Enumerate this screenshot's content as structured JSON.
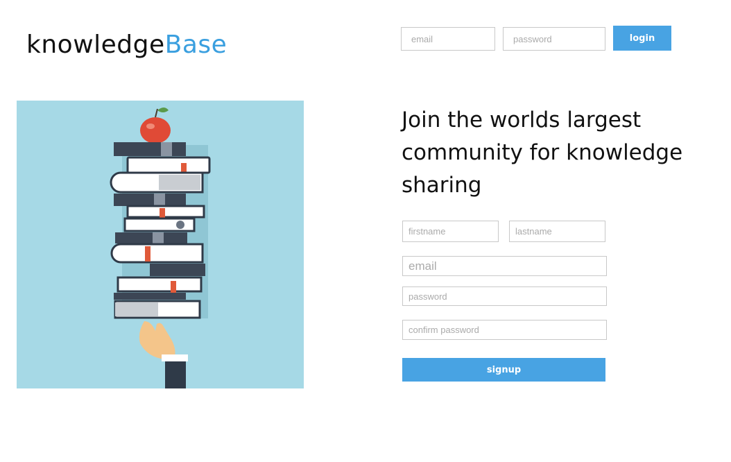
{
  "brand": {
    "prefix": "knowledge",
    "accent": "Base",
    "accent_color": "#3a9fdf"
  },
  "header_login": {
    "email_placeholder": "email",
    "password_placeholder": "password",
    "login_label": "login"
  },
  "hero_image": {
    "subject": "stack-of-books-with-apple-on-hand"
  },
  "headline": "Join the worlds largest community for knowledge sharing",
  "signup_form": {
    "firstname_placeholder": "firstname",
    "lastname_placeholder": "lastname",
    "email_placeholder": "email",
    "password_placeholder": "password",
    "confirm_password_placeholder": "confirm password",
    "signup_label": "signup"
  },
  "colors": {
    "button": "#48a3e3",
    "hero_bg": "#a6d9e6"
  }
}
